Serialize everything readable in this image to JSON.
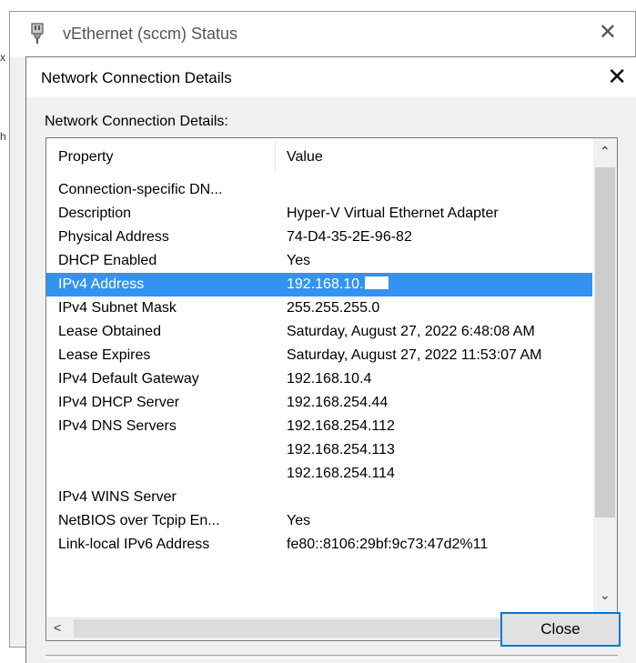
{
  "background_window": {
    "title": "vEthernet (sccm) Status",
    "close_glyph": "✕",
    "edge_marks": [
      "x",
      "h"
    ]
  },
  "dialog": {
    "title": "Network Connection Details",
    "close_glyph": "✕",
    "group_label": "Network Connection Details:",
    "columns": {
      "property": "Property",
      "value": "Value"
    },
    "rows": [
      {
        "property": "Connection-specific DN...",
        "value": ""
      },
      {
        "property": "Description",
        "value": "Hyper-V Virtual Ethernet Adapter"
      },
      {
        "property": "Physical Address",
        "value": "74-D4-35-2E-96-82"
      },
      {
        "property": "DHCP Enabled",
        "value": "Yes"
      },
      {
        "property": "IPv4 Address",
        "value": "192.168.10.",
        "redacted": true,
        "selected": true
      },
      {
        "property": "IPv4 Subnet Mask",
        "value": "255.255.255.0"
      },
      {
        "property": "Lease Obtained",
        "value": "Saturday, August 27, 2022 6:48:08 AM"
      },
      {
        "property": "Lease Expires",
        "value": "Saturday, August 27, 2022 11:53:07 AM"
      },
      {
        "property": "IPv4 Default Gateway",
        "value": "192.168.10.4"
      },
      {
        "property": "IPv4 DHCP Server",
        "value": "192.168.254.44"
      },
      {
        "property": "IPv4 DNS Servers",
        "value": "192.168.254.112"
      },
      {
        "property": "",
        "value": "192.168.254.113"
      },
      {
        "property": "",
        "value": "192.168.254.114"
      },
      {
        "property": "IPv4 WINS Server",
        "value": ""
      },
      {
        "property": "NetBIOS over Tcpip En...",
        "value": "Yes"
      },
      {
        "property": "Link-local IPv6 Address",
        "value": "fe80::8106:29bf:9c73:47d2%11"
      }
    ],
    "scroll_arrows": {
      "up": "⌃",
      "down": "⌄",
      "left": "<",
      "right": ">"
    },
    "close_button_label": "Close"
  },
  "icons": {
    "network-adapter-icon": "plug",
    "selection_color": "#3393f0",
    "focus_color": "#0078d7"
  }
}
